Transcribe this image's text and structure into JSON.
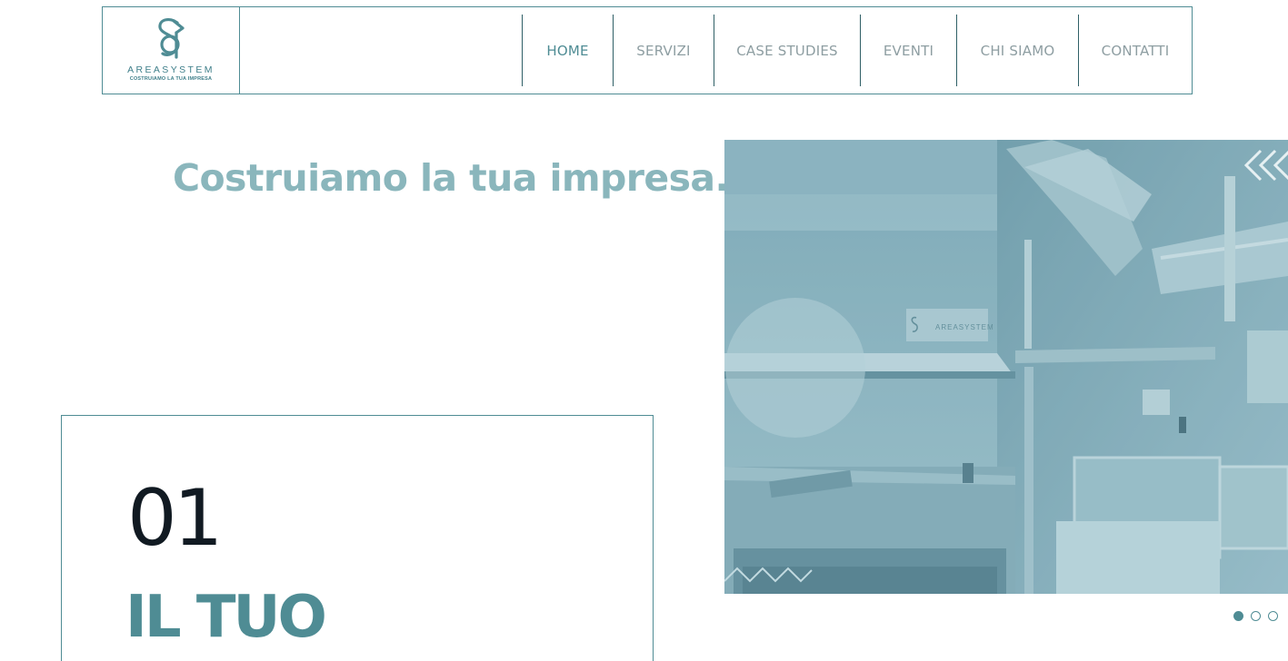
{
  "brand": {
    "name": "AREASYSTEM",
    "tagline": "COSTRUIAMO LA TUA IMPRESA",
    "primary_color": "#4f8c94",
    "logo_icon": "s-hook-logo-icon"
  },
  "nav": {
    "items": [
      {
        "label": "HOME",
        "active": true
      },
      {
        "label": "SERVIZI",
        "active": false
      },
      {
        "label": "CASE STUDIES",
        "active": false
      },
      {
        "label": "EVENTI",
        "active": false
      },
      {
        "label": "CHI SIAMO",
        "active": false
      },
      {
        "label": "CONTATTI",
        "active": false
      }
    ]
  },
  "hero": {
    "headline": "Costruiamo la tua impresa.",
    "headline_color": "#8ab6bc"
  },
  "card": {
    "number": "01",
    "heading": "IL TUO"
  },
  "slider": {
    "image_sign_text": "AREASYSTEM",
    "prev_icon": "double-chevron-left-icon",
    "overlay_color": "#8db5c0",
    "slide_count": 3,
    "active_slide": 1
  }
}
